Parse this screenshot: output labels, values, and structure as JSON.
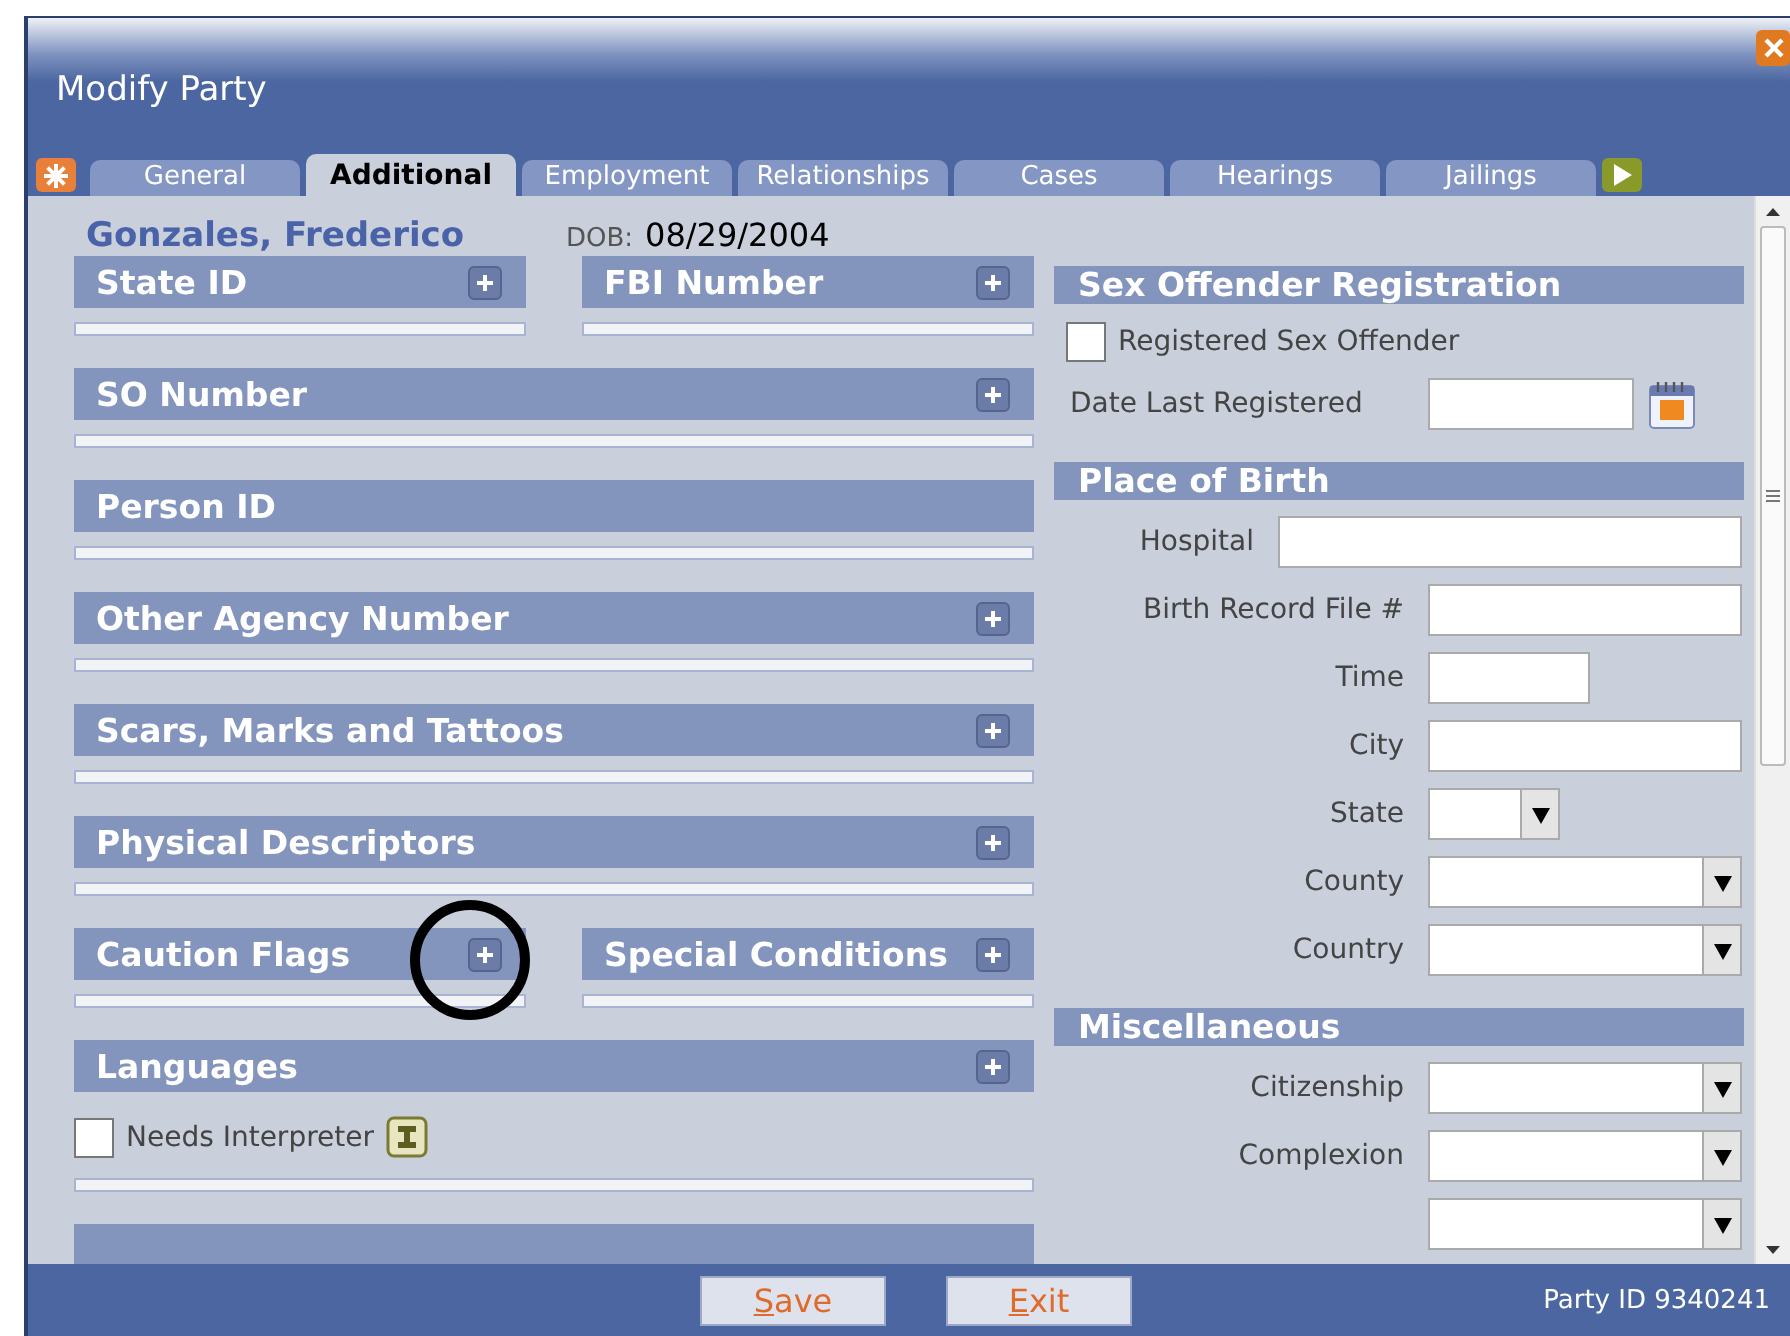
{
  "window": {
    "title": "Modify Party"
  },
  "tabs": [
    {
      "label": "General",
      "selected": false
    },
    {
      "label": "Additional",
      "selected": true
    },
    {
      "label": "Employment",
      "selected": false
    },
    {
      "label": "Relationships",
      "selected": false
    },
    {
      "label": "Cases",
      "selected": false
    },
    {
      "label": "Hearings",
      "selected": false
    },
    {
      "label": "Jailings",
      "selected": false
    }
  ],
  "person": {
    "name": "Gonzales, Frederico",
    "dob_label": "DOB:",
    "dob": "08/29/2004"
  },
  "left_rows": [
    {
      "sections": [
        {
          "title": "State ID",
          "add_button": true
        },
        {
          "title": "FBI Number",
          "add_button": true
        }
      ]
    },
    {
      "sections": [
        {
          "title": "SO Number",
          "add_button": true
        }
      ]
    },
    {
      "sections": [
        {
          "title": "Person ID",
          "add_button": false
        }
      ]
    },
    {
      "sections": [
        {
          "title": "Other Agency Number",
          "add_button": true
        }
      ]
    },
    {
      "sections": [
        {
          "title": "Scars, Marks and Tattoos",
          "add_button": true
        }
      ]
    },
    {
      "sections": [
        {
          "title": "Physical Descriptors",
          "add_button": true
        }
      ]
    },
    {
      "sections": [
        {
          "title": "Caution Flags",
          "add_button": true
        },
        {
          "title": "Special Conditions",
          "add_button": true
        }
      ]
    },
    {
      "sections": [
        {
          "title": "Languages",
          "add_button": true,
          "checkbox": {
            "label": "Needs Interpreter",
            "checked": false
          }
        }
      ]
    },
    {
      "sections": [
        {
          "add_button": false
        }
      ]
    }
  ],
  "sex_offender": {
    "title": "Sex Offender Registration",
    "checkbox": {
      "label": "Registered Sex Offender",
      "checked": false
    },
    "date_label": "Date Last Registered"
  },
  "right_sections": [
    {
      "title": "Place of Birth",
      "fields": [
        {
          "label": "Hospital",
          "kind": "wide"
        },
        {
          "label": "Birth Record File #",
          "kind": "text"
        },
        {
          "label": "Time",
          "kind": "short"
        },
        {
          "label": "City",
          "kind": "text"
        },
        {
          "label": "State",
          "kind": "smallselect"
        },
        {
          "label": "County",
          "kind": "select"
        },
        {
          "label": "Country",
          "kind": "select"
        }
      ]
    },
    {
      "title": "Miscellaneous",
      "fields": [
        {
          "label": "Citizenship",
          "kind": "select"
        },
        {
          "label": "Complexion",
          "kind": "select"
        },
        {
          "kind": "select"
        }
      ]
    }
  ],
  "footer": {
    "buttons": [
      "Save",
      "Exit"
    ],
    "party_id": "Party ID 9340241"
  }
}
